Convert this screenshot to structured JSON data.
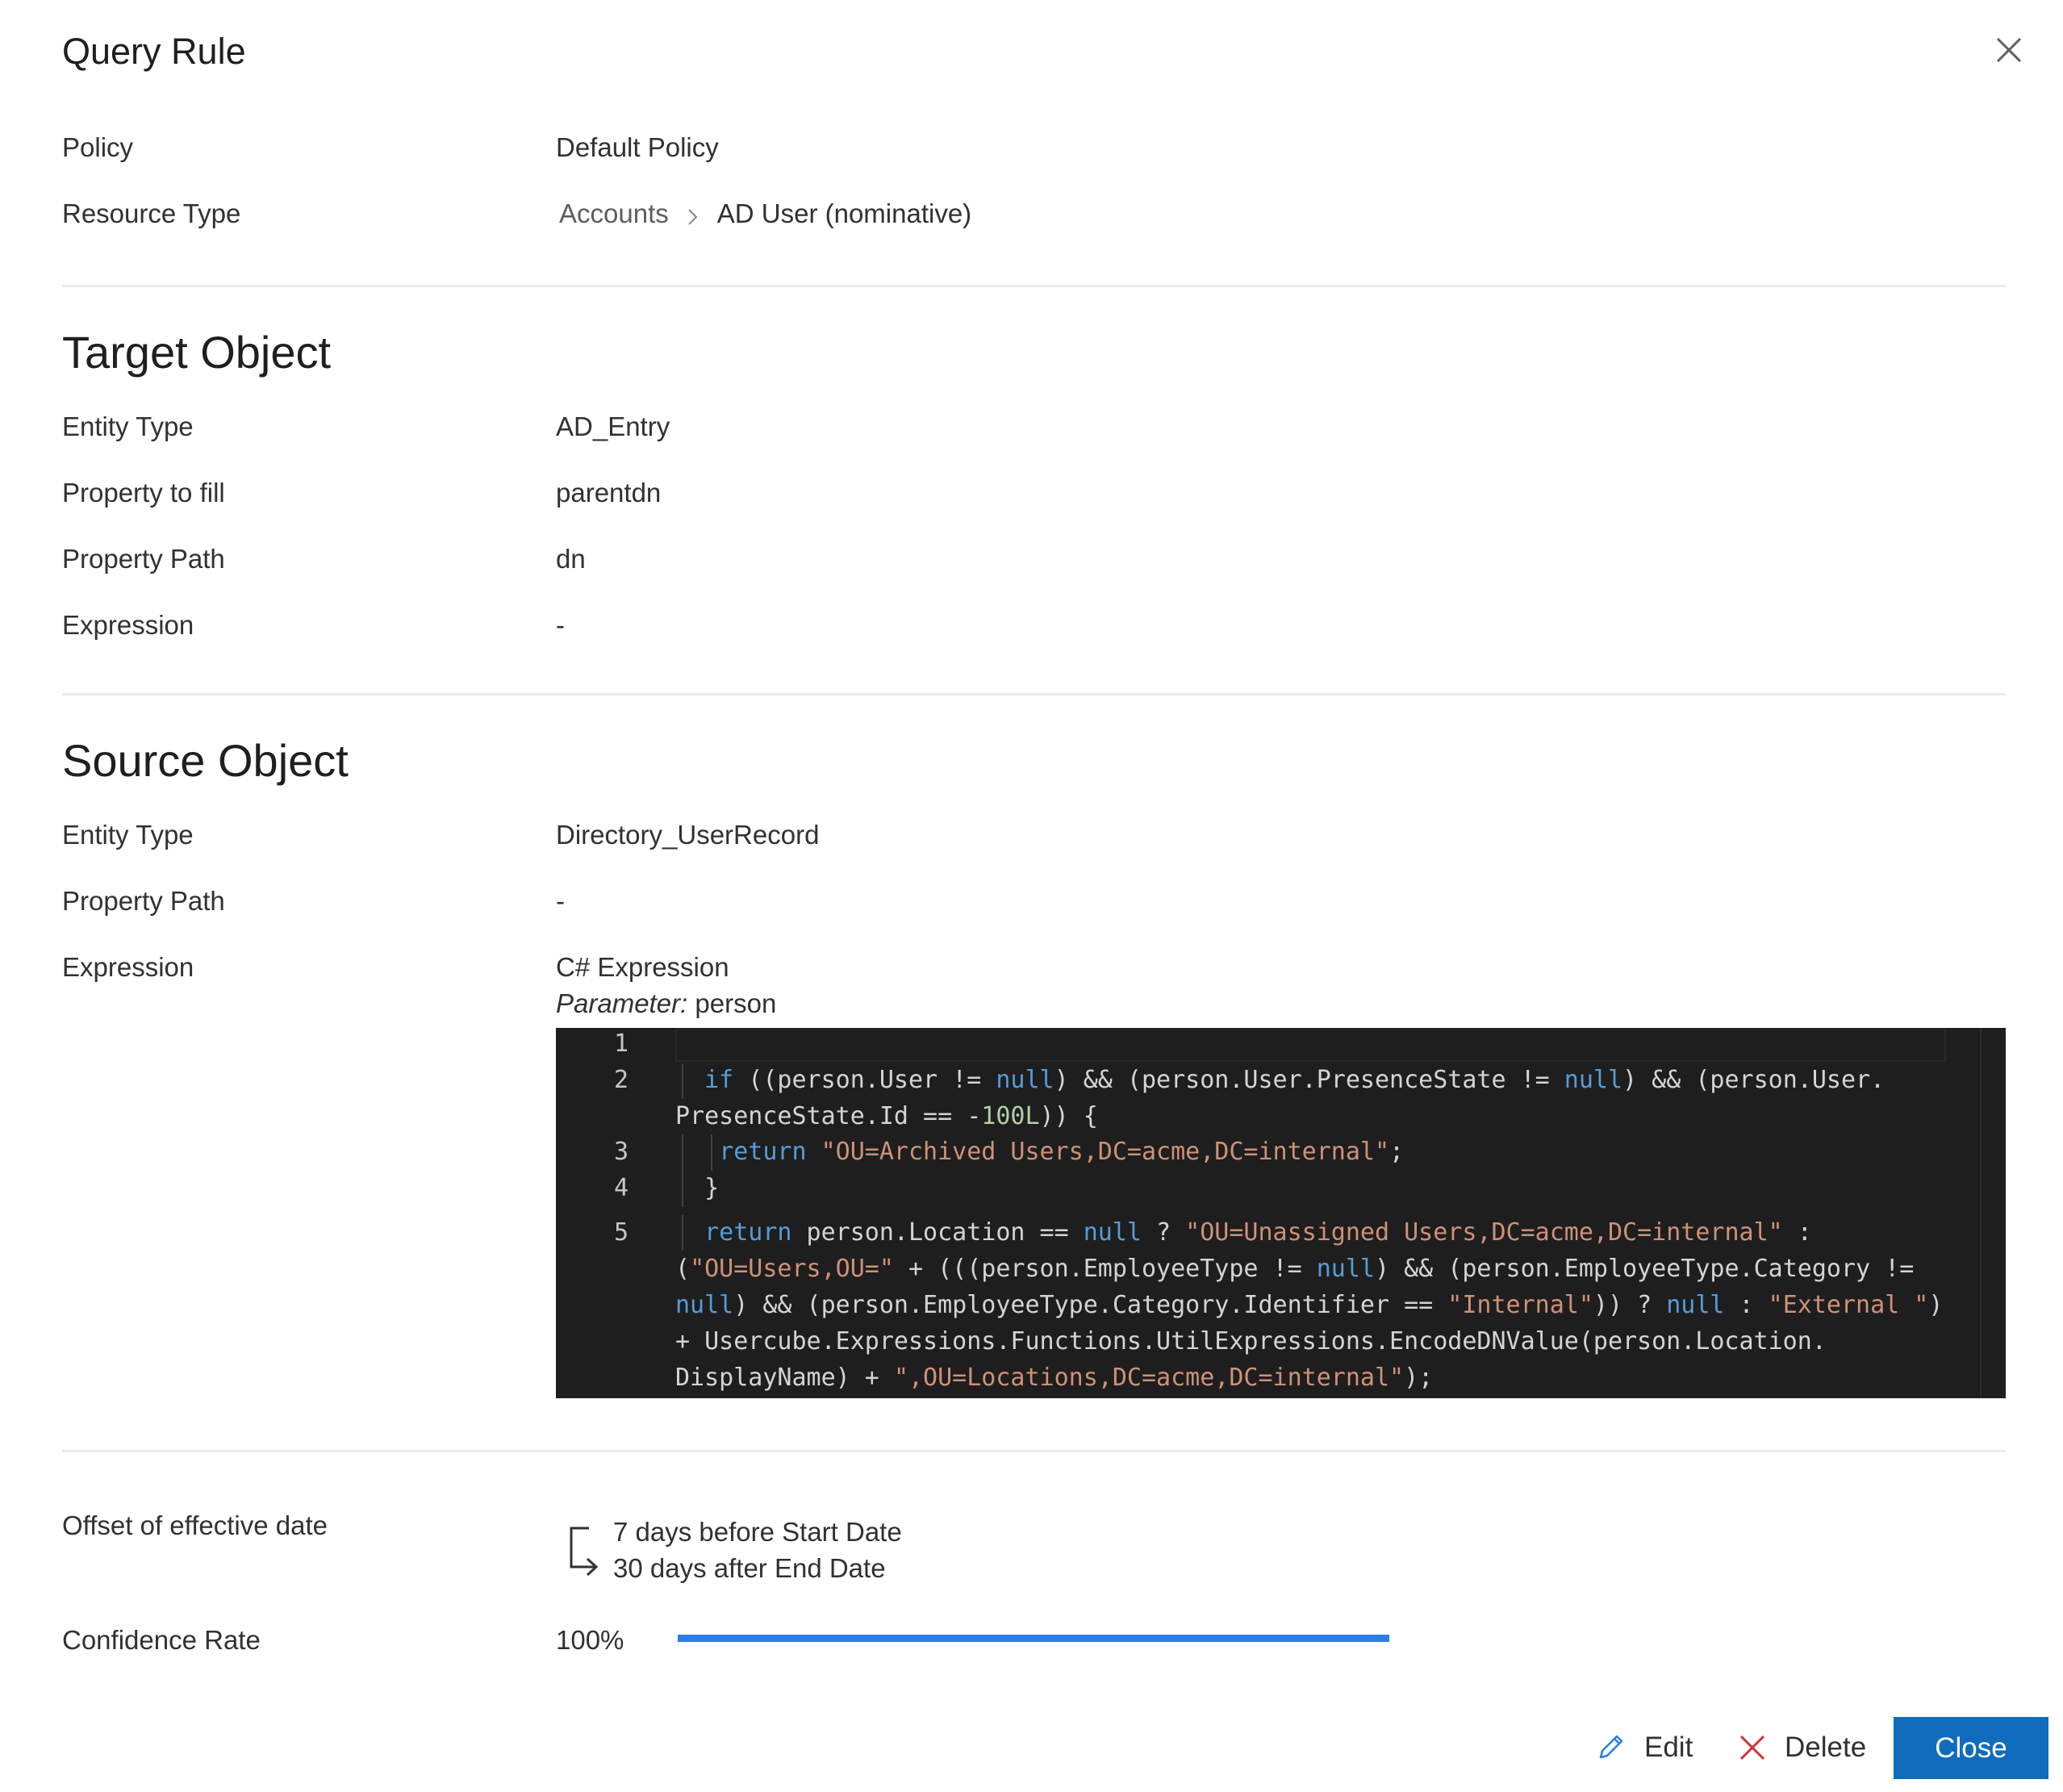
{
  "dialog": {
    "title": "Query Rule",
    "close_icon": "close-icon"
  },
  "general": {
    "policy_label": "Policy",
    "policy_value": "Default Policy",
    "resource_type_label": "Resource Type",
    "resource_type_breadcrumb": [
      "Accounts",
      "AD User (nominative)"
    ],
    "breadcrumb_separator_icon": "chevron-right-icon"
  },
  "target_object": {
    "heading": "Target Object",
    "entity_type_label": "Entity Type",
    "entity_type_value": "AD_Entry",
    "property_to_fill_label": "Property to fill",
    "property_to_fill_value": "parentdn",
    "property_path_label": "Property Path",
    "property_path_value": "dn",
    "expression_label": "Expression",
    "expression_value": "-"
  },
  "source_object": {
    "heading": "Source Object",
    "entity_type_label": "Entity Type",
    "entity_type_value": "Directory_UserRecord",
    "property_path_label": "Property Path",
    "property_path_value": "-",
    "expression_label": "Expression",
    "expression_type": "C# Expression",
    "parameter_label": "Parameter:",
    "parameter_value": "person",
    "code": {
      "line_numbers": [
        "1",
        "2",
        "3",
        "4",
        "5"
      ],
      "lines": [
        "",
        "if ((person.User != null) && (person.User.PresenceState != null) && (person.User.",
        "PresenceState.Id == -100L)) {",
        "return \"OU=Archived Users,DC=acme,DC=internal\";",
        "}",
        "return person.Location == null ? \"OU=Unassigned Users,DC=acme,DC=internal\" :",
        "(\"OU=Users,OU=\" + (((person.EmployeeType != null) && (person.EmployeeType.Category !=",
        "null) && (person.EmployeeType.Category.Identifier == \"Internal\")) ? null : \"External \")",
        "+ Usercube.Expressions.Functions.UtilExpressions.EncodeDNValue(person.Location.",
        "DisplayName) + \",OU=Locations,DC=acme,DC=internal\");"
      ],
      "colors": {
        "background": "#1e1e1e",
        "keyword": "#569cd6",
        "string": "#ce9178",
        "number": "#b5cea8",
        "text": "#d4d4d4"
      }
    }
  },
  "settings": {
    "offset_label": "Offset of effective date",
    "offset_icon": "offset-arrow-icon",
    "offset_before": "7 days before Start Date",
    "offset_after": "30 days after End Date",
    "confidence_label": "Confidence Rate",
    "confidence_text": "100%",
    "confidence_value": 100,
    "progress_color": "#2b7de9"
  },
  "footer": {
    "edit_label": "Edit",
    "edit_icon": "pencil-icon",
    "delete_label": "Delete",
    "delete_icon": "delete-x-icon",
    "close_label": "Close",
    "primary_color": "#0f6cbd"
  }
}
